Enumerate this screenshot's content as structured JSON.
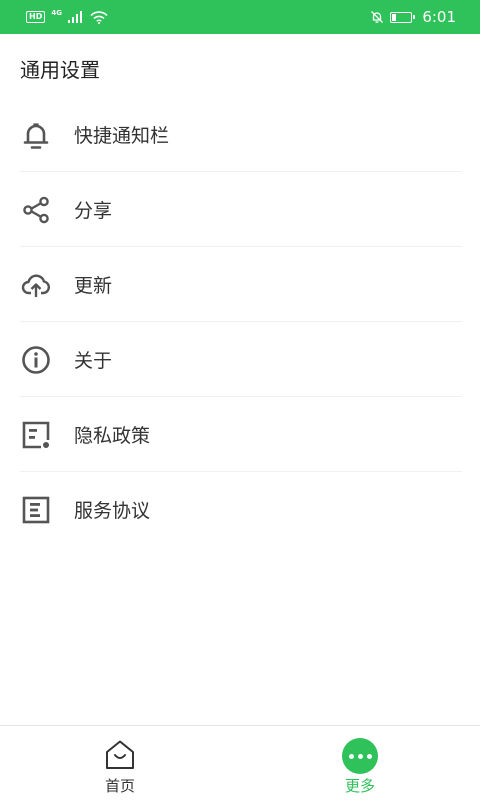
{
  "status_bar": {
    "hd": "HD",
    "network": "4G",
    "time": "6:01",
    "icons": [
      "signal-icon",
      "wifi-icon",
      "mute-bell-icon",
      "battery-icon"
    ]
  },
  "page_title": "通用设置",
  "menu": [
    {
      "label": "快捷通知栏",
      "icon": "bell-icon"
    },
    {
      "label": "分享",
      "icon": "share-icon"
    },
    {
      "label": "更新",
      "icon": "cloud-upload-icon"
    },
    {
      "label": "关于",
      "icon": "info-icon"
    },
    {
      "label": "隐私政策",
      "icon": "privacy-doc-icon"
    },
    {
      "label": "服务协议",
      "icon": "agreement-doc-icon"
    }
  ],
  "bottom_nav": {
    "home_label": "首页",
    "more_label": "更多"
  },
  "colors": {
    "accent": "#2fc15a",
    "icon": "#555555",
    "divider": "#f0f0f0"
  }
}
